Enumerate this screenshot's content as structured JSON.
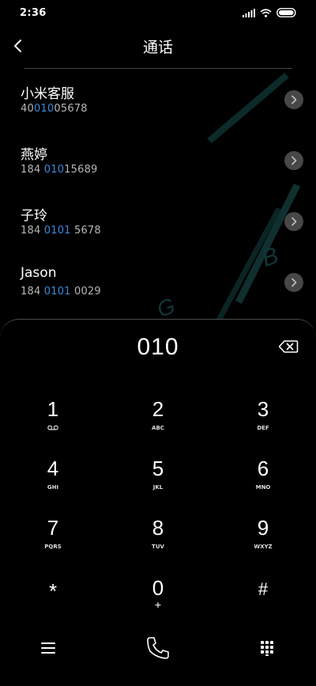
{
  "status_bar": {
    "time": "2:36"
  },
  "header": {
    "title": "通话"
  },
  "contacts": [
    {
      "name": "小米客服",
      "number_pre": "40",
      "number_hl": "010",
      "number_post": "05678"
    },
    {
      "name": "燕婷",
      "number_pre": "184 ",
      "number_hl": "010",
      "number_post": "15689"
    },
    {
      "name": "子玲",
      "number_pre": "184 ",
      "number_hl": "0101",
      "number_post": " 5678"
    },
    {
      "name": "Jason",
      "number_pre": "184 ",
      "number_hl": "0101",
      "number_post": " 0029"
    }
  ],
  "dialer": {
    "display": "010",
    "keys": [
      {
        "digit": "1",
        "letters": "voicemail-icon"
      },
      {
        "digit": "2",
        "letters": "ABC"
      },
      {
        "digit": "3",
        "letters": "DEF"
      },
      {
        "digit": "4",
        "letters": "GHI"
      },
      {
        "digit": "5",
        "letters": "JKL"
      },
      {
        "digit": "6",
        "letters": "MNO"
      },
      {
        "digit": "7",
        "letters": "PQRS"
      },
      {
        "digit": "8",
        "letters": "TUV"
      },
      {
        "digit": "9",
        "letters": "WXYZ"
      },
      {
        "digit": "*",
        "letters": ""
      },
      {
        "digit": "0",
        "letters": "+"
      },
      {
        "digit": "#",
        "letters": ""
      }
    ]
  },
  "icons": {
    "back": "chevron-left-icon",
    "backspace": "backspace-icon",
    "menu": "menu-icon",
    "call": "phone-icon",
    "keypad": "keypad-icon"
  },
  "colors": {
    "highlight": "#3b88de",
    "background": "#000000"
  }
}
